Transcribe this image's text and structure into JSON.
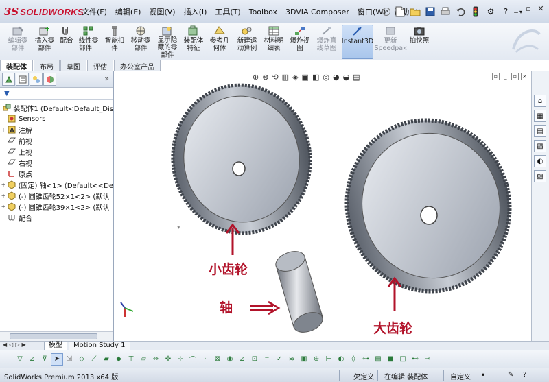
{
  "app": {
    "logo_ds": "3S",
    "logo_text": "SOLIDWORKS"
  },
  "menu": [
    "文件(F)",
    "编辑(E)",
    "视图(V)",
    "插入(I)",
    "工具(T)",
    "Toolbox",
    "3DVIA Composer",
    "窗口(W)",
    "帮助(H)"
  ],
  "toolbar_commands": [
    {
      "label": "编辑零\n部件",
      "icon": "edit-component-icon",
      "disabled": true
    },
    {
      "label": "插入零\n部件",
      "icon": "insert-component-icon"
    },
    {
      "label": "配合",
      "icon": "mate-icon"
    },
    {
      "label": "线性零\n部件...",
      "icon": "linear-pattern-icon"
    },
    {
      "label": "智能扣\n件",
      "icon": "smart-fastener-icon"
    },
    {
      "label": "移动零\n部件",
      "icon": "move-component-icon"
    },
    {
      "label": "显示隐\n藏的零\n部件",
      "icon": "show-hidden-icon"
    },
    {
      "label": "装配体\n特征",
      "icon": "assembly-feature-icon"
    },
    {
      "label": "参考几\n何体",
      "icon": "reference-geometry-icon"
    },
    {
      "label": "新建运\n动算例",
      "icon": "new-motion-study-icon"
    },
    {
      "label": "材料明\n细表",
      "icon": "bom-icon"
    },
    {
      "label": "爆炸视\n图",
      "icon": "exploded-view-icon"
    },
    {
      "label": "爆炸直\n线草图",
      "icon": "explode-line-sketch-icon"
    },
    {
      "label": "Instant3D",
      "icon": "instant3d-icon",
      "active": true
    },
    {
      "label": "更新\nSpeedpak",
      "icon": "speedpak-icon",
      "disabled": true
    },
    {
      "label": "拍快照",
      "icon": "snapshot-icon"
    }
  ],
  "cmd_tabs": [
    "装配体",
    "布局",
    "草图",
    "评估",
    "办公室产品"
  ],
  "tree": {
    "filter_label": "▼",
    "root": "装配体1  (Default<Default_Dis",
    "items": [
      {
        "label": "Sensors",
        "icon": "sensors-icon",
        "expand": ""
      },
      {
        "label": "注解",
        "icon": "annotations-icon",
        "expand": "+"
      },
      {
        "label": "前视",
        "icon": "plane-icon",
        "expand": ""
      },
      {
        "label": "上视",
        "icon": "plane-icon",
        "expand": ""
      },
      {
        "label": "右视",
        "icon": "plane-icon",
        "expand": ""
      },
      {
        "label": "原点",
        "icon": "origin-icon",
        "expand": ""
      },
      {
        "label": "(固定) 轴<1> (Default<<De",
        "icon": "part-icon",
        "expand": "+"
      },
      {
        "label": "(-) 圆锥齿轮52×1<2> (默认",
        "icon": "part-icon",
        "expand": "+"
      },
      {
        "label": "(-) 圆锥齿轮39×1<2> (默认",
        "icon": "part-icon",
        "expand": "+"
      },
      {
        "label": "配合",
        "icon": "mates-folder-icon",
        "expand": ""
      }
    ]
  },
  "annotations": {
    "small_gear": "小齿轮",
    "shaft": "轴",
    "large_gear": "大齿轮"
  },
  "bottom_tabs": [
    "模型",
    "Motion Study 1"
  ],
  "status": {
    "version": "SolidWorks Premium 2013 x64 版",
    "state": "欠定义",
    "editing": "在编辑 装配体",
    "custom": "自定义"
  },
  "colors": {
    "annotation": "#b2132a",
    "brand": "#c8102e"
  }
}
